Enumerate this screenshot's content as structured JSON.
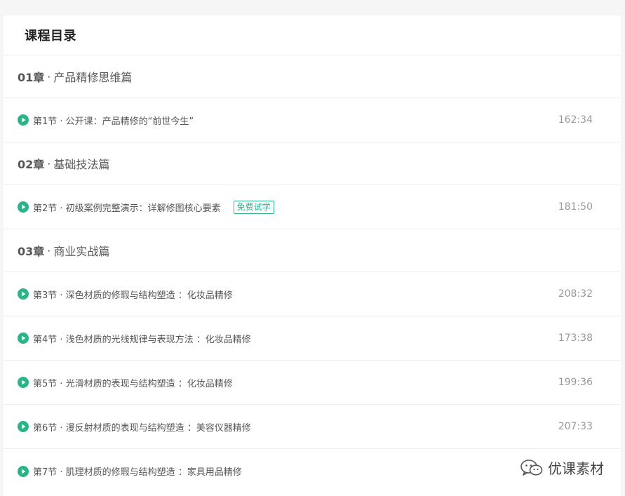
{
  "catalog": {
    "title": "课程目录"
  },
  "chapters": [
    {
      "no": "01章",
      "sep": "·",
      "name": "产品精修思维篇",
      "lessons": [
        {
          "title": "第1节 · 公开课：产品精修的“前世今生”",
          "badge": "",
          "duration": "162:34"
        }
      ]
    },
    {
      "no": "02章",
      "sep": "·",
      "name": "基础技法篇",
      "lessons": [
        {
          "title": "第2节 · 初级案例完整演示：详解修图核心要素",
          "badge": "免费试学",
          "duration": "181:50"
        }
      ]
    },
    {
      "no": "03章",
      "sep": "·",
      "name": "商业实战篇",
      "lessons": [
        {
          "title": "第3节 · 深色材质的修瑕与结构塑造 ：化妆品精修",
          "badge": "",
          "duration": "208:32"
        },
        {
          "title": "第4节 · 浅色材质的光线规律与表现方法 ：化妆品精修",
          "badge": "",
          "duration": "173:38"
        },
        {
          "title": "第5节 · 光滑材质的表现与结构塑造 ：化妆品精修",
          "badge": "",
          "duration": "199:36"
        },
        {
          "title": "第6节 · 漫反射材质的表现与结构塑造 ：美容仪器精修",
          "badge": "",
          "duration": "207:33"
        },
        {
          "title": "第7节 · 肌理材质的修瑕与结构塑造 ：家具用品精修",
          "badge": "",
          "duration": ""
        }
      ]
    }
  ],
  "watermark": {
    "text": "优课素材",
    "icon": "wechat-icon"
  },
  "colors": {
    "accent": "#2bb38a",
    "duration": "#999999",
    "divider": "#eeeeee"
  }
}
